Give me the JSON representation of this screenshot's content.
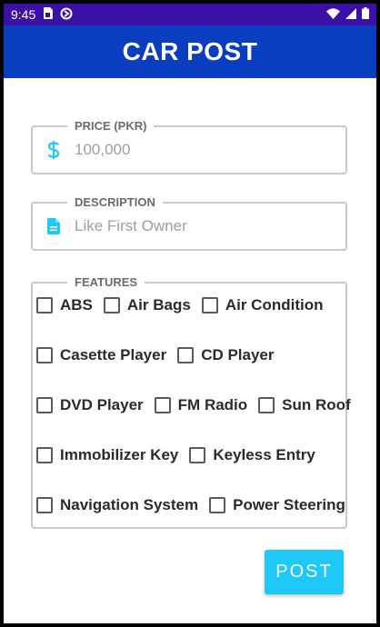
{
  "status_bar": {
    "time": "9:45",
    "icons": [
      "sim-card-icon",
      "sync-icon",
      "wifi-icon",
      "signal-icon",
      "battery-icon"
    ]
  },
  "app_bar": {
    "title": "CAR POST"
  },
  "price": {
    "label": "PRICE (PKR)",
    "value": "",
    "placeholder": "100,000",
    "icon": "dollar-icon"
  },
  "description": {
    "label": "DESCRIPTION",
    "value": "",
    "placeholder": "Like First Owner",
    "icon": "document-icon"
  },
  "features": {
    "label": "FEATURES",
    "rows": [
      [
        {
          "label": "ABS",
          "checked": false
        },
        {
          "label": "Air Bags",
          "checked": false
        },
        {
          "label": "Air Condition",
          "checked": false
        }
      ],
      [
        {
          "label": "Casette Player",
          "checked": false
        },
        {
          "label": "CD Player",
          "checked": false
        }
      ],
      [
        {
          "label": "DVD Player",
          "checked": false
        },
        {
          "label": "FM Radio",
          "checked": false
        },
        {
          "label": "Sun Roof",
          "checked": false
        }
      ],
      [
        {
          "label": "Immobilizer Key",
          "checked": false
        },
        {
          "label": "Keyless Entry",
          "checked": false
        }
      ],
      [
        {
          "label": "Navigation System",
          "checked": false
        },
        {
          "label": "Power Steering",
          "checked": false
        }
      ]
    ]
  },
  "post_button": {
    "label": "POST"
  },
  "colors": {
    "status_bar": "#3b10a6",
    "app_bar": "#0a3ec0",
    "accent": "#1ec8f7"
  }
}
